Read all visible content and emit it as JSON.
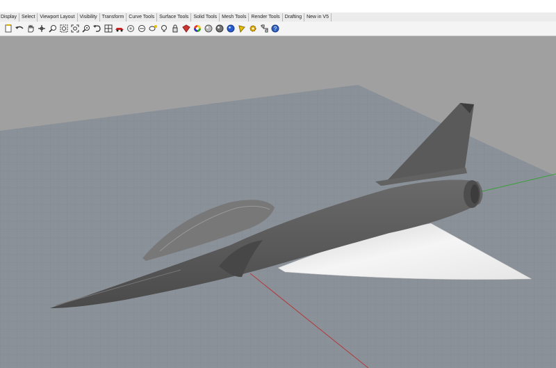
{
  "menu_tabs": [
    {
      "label": "Display"
    },
    {
      "label": "Select"
    },
    {
      "label": "Viewport Layout"
    },
    {
      "label": "Visibility"
    },
    {
      "label": "Transform"
    },
    {
      "label": "Curve Tools"
    },
    {
      "label": "Surface Tools"
    },
    {
      "label": "Solid Tools"
    },
    {
      "label": "Mesh Tools"
    },
    {
      "label": "Render Tools"
    },
    {
      "label": "Drafting"
    },
    {
      "label": "New in V5"
    }
  ],
  "toolbar_icons": [
    "new-file-icon",
    "undo-icon",
    "pan-hand-icon",
    "rotate-view-icon",
    "zoom-icon",
    "zoom-window-icon",
    "zoom-extents-icon",
    "zoom-selected-icon",
    "undo-view-icon",
    "four-viewports-icon",
    "car-icon",
    "object-properties-icon",
    "layer-icon",
    "named-view-icon",
    "light-bulb-icon",
    "lock-icon",
    "shaded-icon",
    "color-wheel-icon",
    "render-sphere-icon",
    "rendered-sphere-icon",
    "blue-sphere-icon",
    "material-icon",
    "gear-settings-icon",
    "options-icon",
    "help-icon"
  ],
  "colors": {
    "background": "#a0a0a0",
    "grid_plane": "#8a9098",
    "grid_line": "#7c828a",
    "x_axis": "#b33a3a",
    "y_axis": "#3aa03a",
    "aircraft_body": "#585858",
    "wing_highlight": "#f2f2f2"
  }
}
